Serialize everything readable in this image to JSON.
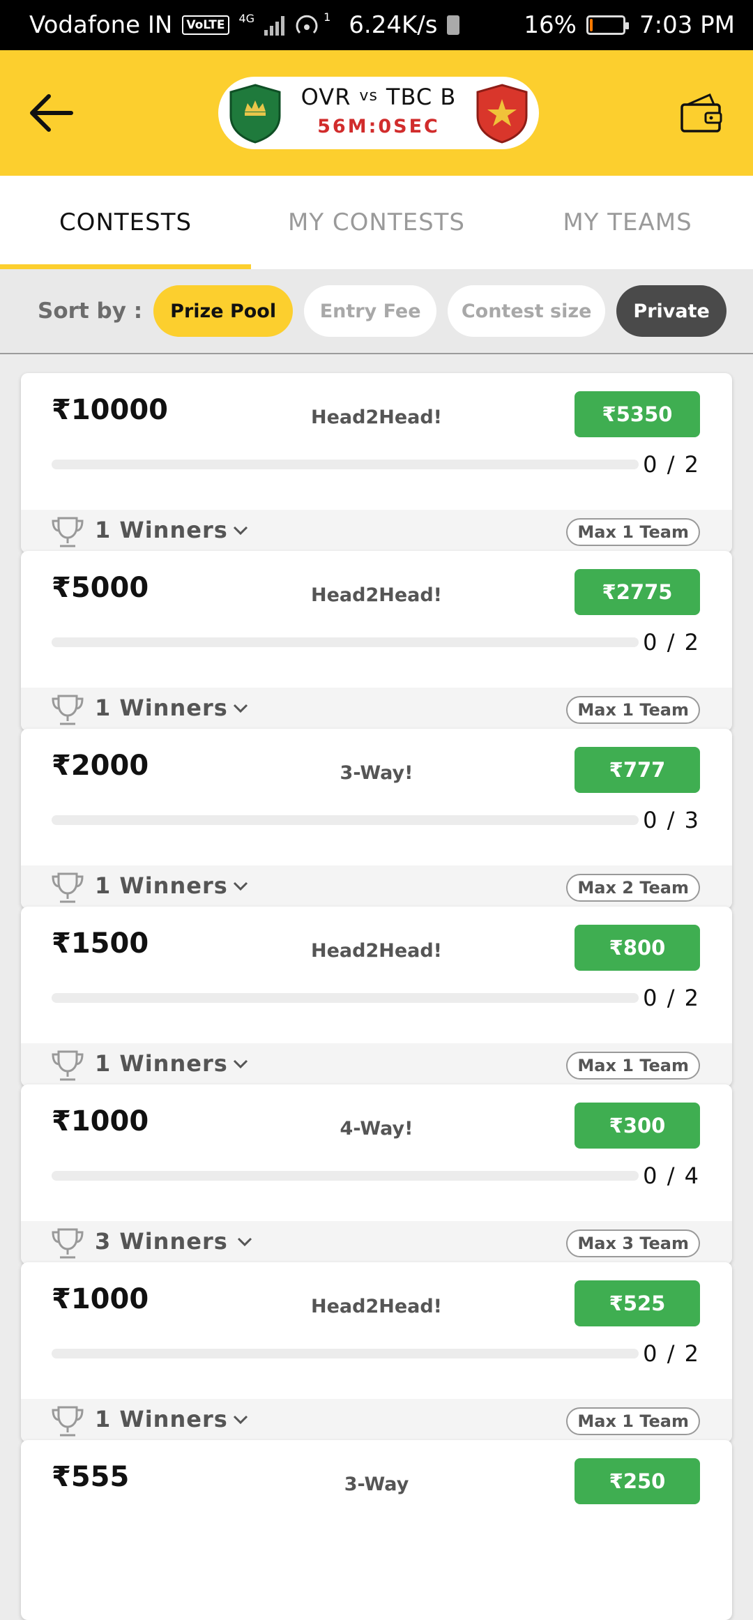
{
  "status_bar": {
    "carrier": "Vodafone IN",
    "volte": "VoLTE",
    "network": "4G",
    "hotspot_count": "1",
    "speed": "6.24K/s",
    "battery_percent": "16%",
    "battery_level": 0.16,
    "time": "7:03 PM"
  },
  "header": {
    "team_left": "OVR",
    "vs": "vs",
    "team_right": "TBC B",
    "countdown": "56M:0SEC",
    "colors": {
      "header_bg": "#fccf2e",
      "countdown": "#d12c2c"
    }
  },
  "tabs": [
    {
      "label": "CONTESTS",
      "active": true
    },
    {
      "label": "MY CONTESTS",
      "active": false
    },
    {
      "label": "MY TEAMS",
      "active": false
    }
  ],
  "sort": {
    "label": "Sort by :",
    "options": [
      "Prize Pool",
      "Entry Fee",
      "Contest size",
      "Private"
    ],
    "selected": "Prize Pool"
  },
  "contests": [
    {
      "prize": "₹10000",
      "type": "Head2Head!",
      "fee": "₹5350",
      "spots": "0 / 2",
      "filled": 0,
      "winners": "1 Winners",
      "max_team": "Max 1 Team"
    },
    {
      "prize": "₹5000",
      "type": "Head2Head!",
      "fee": "₹2775",
      "spots": "0 / 2",
      "filled": 0,
      "winners": "1 Winners",
      "max_team": "Max 1 Team"
    },
    {
      "prize": "₹2000",
      "type": "3-Way!",
      "fee": "₹777",
      "spots": "0 / 3",
      "filled": 0,
      "winners": "1 Winners",
      "max_team": "Max 2 Team"
    },
    {
      "prize": "₹1500",
      "type": "Head2Head!",
      "fee": "₹800",
      "spots": "0 / 2",
      "filled": 0,
      "winners": "1 Winners",
      "max_team": "Max 1 Team"
    },
    {
      "prize": "₹1000",
      "type": "4-Way!",
      "fee": "₹300",
      "spots": "0 / 4",
      "filled": 0,
      "winners": "3 Winners",
      "max_team": "Max 3 Team"
    },
    {
      "prize": "₹1000",
      "type": "Head2Head!",
      "fee": "₹525",
      "spots": "0 / 2",
      "filled": 0,
      "winners": "1 Winners",
      "max_team": "Max 1 Team"
    },
    {
      "prize": "₹555",
      "type": "3-Way",
      "fee": "₹250"
    }
  ]
}
